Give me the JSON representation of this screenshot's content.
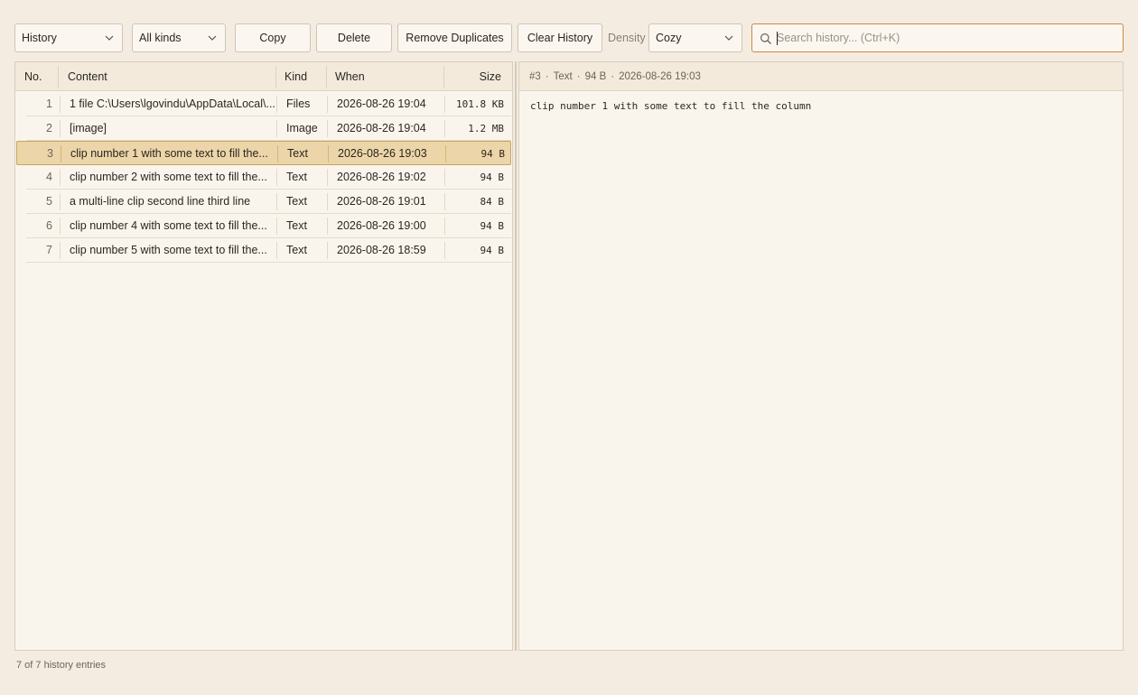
{
  "toolbar": {
    "view_select": "History",
    "kind_select": "All kinds",
    "copy_label": "Copy",
    "delete_label": "Delete",
    "remove_duplicates_label": "Remove Duplicates",
    "clear_history_label": "Clear History",
    "density_label": "Density",
    "density_select": "Cozy",
    "search_placeholder": "Search history...  (Ctrl+K)",
    "search_value": ""
  },
  "table": {
    "columns": {
      "no": "No.",
      "content": "Content",
      "kind": "Kind",
      "when": "When",
      "size": "Size"
    },
    "selected_index": 2,
    "rows": [
      {
        "no": "1",
        "content": "1 file C:\\Users\\lgovindu\\AppData\\Local\\...",
        "kind": "Files",
        "when": "2026-08-26 19:04",
        "size": "101.8 KB"
      },
      {
        "no": "2",
        "content": "[image]",
        "kind": "Image",
        "when": "2026-08-26 19:04",
        "size": "1.2 MB"
      },
      {
        "no": "3",
        "content": "clip number 1 with some text to fill the...",
        "kind": "Text",
        "when": "2026-08-26 19:03",
        "size": "94 B"
      },
      {
        "no": "4",
        "content": "clip number 2 with some text to fill the...",
        "kind": "Text",
        "when": "2026-08-26 19:02",
        "size": "94 B"
      },
      {
        "no": "5",
        "content": "a multi-line clip second line third line",
        "kind": "Text",
        "when": "2026-08-26 19:01",
        "size": "84 B"
      },
      {
        "no": "6",
        "content": "clip number 4 with some text to fill the...",
        "kind": "Text",
        "when": "2026-08-26 19:00",
        "size": "94 B"
      },
      {
        "no": "7",
        "content": "clip number 5 with some text to fill the...",
        "kind": "Text",
        "when": "2026-08-26 18:59",
        "size": "94 B"
      }
    ]
  },
  "detail": {
    "id": "#3",
    "kind": "Text",
    "size": "94 B",
    "when": "2026-08-26 19:03",
    "body": "clip number 1 with some text to fill the column"
  },
  "status": {
    "text": "7 of 7 history entries"
  },
  "colors": {
    "accent": "#c98a44",
    "selection": "#ecd5a8",
    "background": "#f4ece0"
  }
}
